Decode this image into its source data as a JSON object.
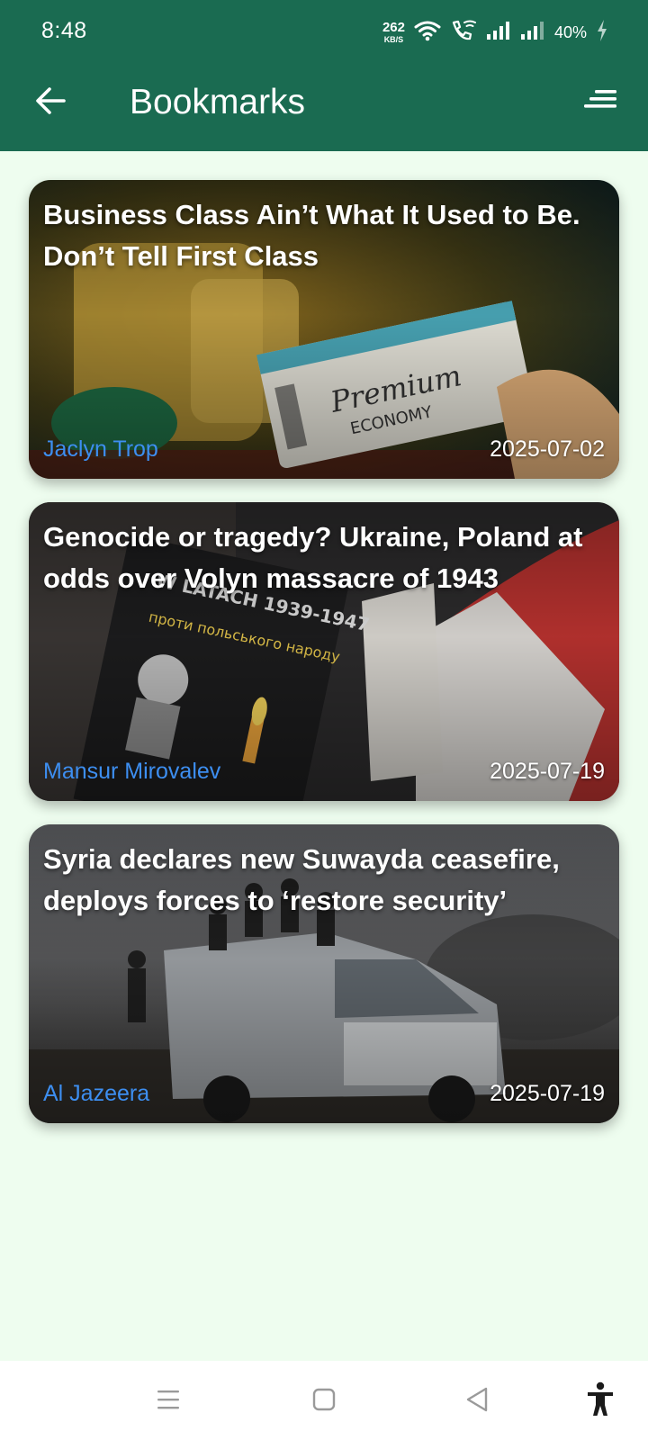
{
  "status_bar": {
    "time": "8:48",
    "net_speed_value": "262",
    "net_speed_unit": "KB/S",
    "battery_percent": "40%"
  },
  "app_bar": {
    "title": "Bookmarks",
    "back_icon": "arrow-left-icon",
    "sort_icon": "sort-icon"
  },
  "bookmarks": [
    {
      "title": "Business Class Ain’t What It Used to Be. Don’t Tell First Class",
      "author": "Jaclyn Trop",
      "date": "2025-07-02"
    },
    {
      "title": "Genocide or tragedy? Ukraine, Poland at odds over Volyn massacre of 1943",
      "author": "Mansur Mirovalev",
      "date": "2025-07-19"
    },
    {
      "title": "Syria declares new Suwayda ceasefire, deploys forces to ‘restore security’",
      "author": "Al Jazeera",
      "date": "2025-07-19"
    }
  ],
  "colors": {
    "app_bar": "#1a6b51",
    "background": "#eefdef",
    "author_link": "#3d8ef0"
  },
  "nav_bar": {
    "icons": [
      "menu-icon",
      "home-square-icon",
      "back-triangle-icon",
      "accessibility-icon"
    ]
  }
}
